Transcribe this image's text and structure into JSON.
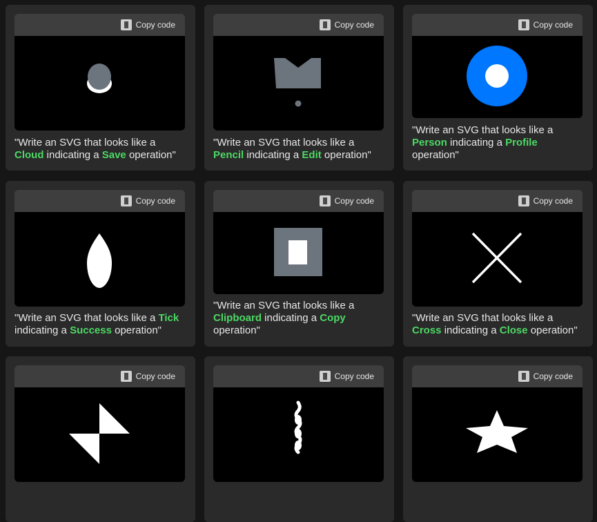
{
  "copy_label": "Copy code",
  "colors": {
    "highlight": "#4cd964",
    "icon_gray": "#6c747d",
    "icon_blue": "#0077ff"
  },
  "cards": [
    {
      "icon": "cloud-save-icon",
      "prefix": "\"Write an SVG that looks like a ",
      "shape": "Cloud",
      "mid": " indicating a ",
      "action": "Save",
      "suffix": " operation\""
    },
    {
      "icon": "pencil-edit-icon",
      "prefix": "\"Write an SVG that looks like a ",
      "shape": "Pencil",
      "mid": " indicating a ",
      "action": "Edit",
      "suffix": " operation\""
    },
    {
      "icon": "person-profile-icon",
      "prefix": "\"Write an SVG that looks like a ",
      "shape": "Person",
      "mid": " indicating a ",
      "action": "Profile",
      "suffix": " operation\""
    },
    {
      "icon": "tick-success-icon",
      "prefix": "\"Write an SVG that looks like a ",
      "shape": "Tick",
      "mid": " indicating a ",
      "action": "Success",
      "suffix": " operation\""
    },
    {
      "icon": "clipboard-copy-icon",
      "prefix": "\"Write an SVG that looks like a ",
      "shape": "Clipboard",
      "mid": " indicating a ",
      "action": "Copy",
      "suffix": " operation\""
    },
    {
      "icon": "cross-close-icon",
      "prefix": "\"Write an SVG that looks like a ",
      "shape": "Cross",
      "mid": " indicating a ",
      "action": "Close",
      "suffix": " operation\""
    },
    {
      "icon": "lightning-icon"
    },
    {
      "icon": "wave-line-icon"
    },
    {
      "icon": "star-icon"
    }
  ]
}
